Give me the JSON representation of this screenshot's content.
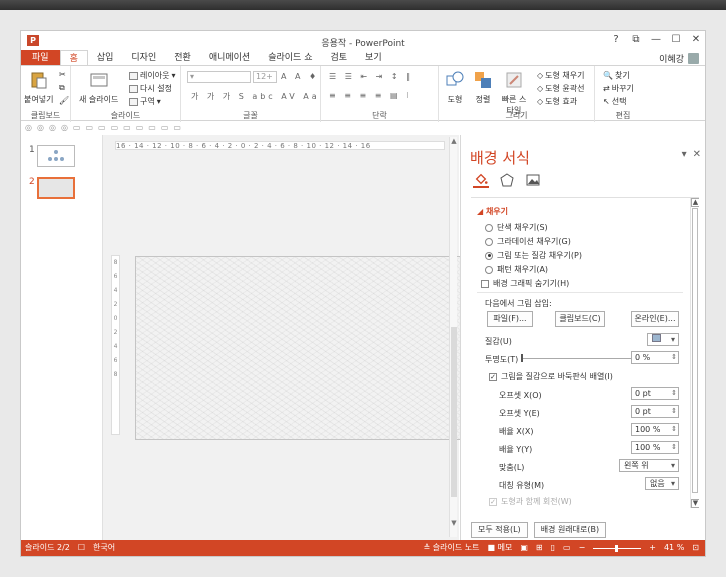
{
  "window": {
    "title": "응용작 - PowerPoint",
    "app_icon": "P",
    "controls": [
      "?",
      "⧉",
      "—",
      "☐",
      "✕"
    ]
  },
  "tabs": [
    {
      "label": "파일",
      "kind": "file"
    },
    {
      "label": "홈",
      "kind": "active"
    },
    {
      "label": "삽입"
    },
    {
      "label": "디자인"
    },
    {
      "label": "전환"
    },
    {
      "label": "애니메이션"
    },
    {
      "label": "슬라이드 쇼"
    },
    {
      "label": "검토"
    },
    {
      "label": "보기"
    }
  ],
  "user": {
    "name": "이혜강"
  },
  "ribbon": {
    "clipboard": {
      "paste": "붙여넣기",
      "label": "클립보드"
    },
    "slides": {
      "new_slide": "새 슬라이드",
      "layout": "레이아웃",
      "reset": "다시 설정",
      "section": "구역",
      "label": "슬라이드"
    },
    "font": {
      "size": "12+",
      "label": "글꼴"
    },
    "paragraph": {
      "label": "단락"
    },
    "drawing": {
      "shape": "도형",
      "arrange": "정렬",
      "quick_style": "빠른 스타일",
      "fill": "도형 채우기",
      "outline": "도형 윤곽선",
      "effect": "도형 효과",
      "label": "그리기"
    },
    "editing": {
      "find": "찾기",
      "replace": "바꾸기",
      "select": "선택",
      "label": "편집"
    }
  },
  "thumbnails": [
    {
      "num": "1"
    },
    {
      "num": "2"
    }
  ],
  "ruler": {
    "horizontal": "16 · 14 · 12 · 10 · 8 · 6 · 4 · 2 · 0 · 2 · 4 · 6 · 8 · 10 · 12 · 14 · 16",
    "vertical": [
      "8",
      "6",
      "4",
      "2",
      "0",
      "2",
      "4",
      "6",
      "8"
    ]
  },
  "pane": {
    "title": "배경 서식",
    "section": "채우기",
    "fill_options": [
      {
        "label": "단색 채우기(S)",
        "checked": false
      },
      {
        "label": "그라데이션 채우기(G)",
        "checked": false
      },
      {
        "label": "그림 또는 질감 채우기(P)",
        "checked": true
      },
      {
        "label": "패턴 채우기(A)",
        "checked": false
      }
    ],
    "hide_graphics": "배경 그래픽 숨기기(H)",
    "insert_from": "다음에서 그림 삽입:",
    "btn_file": "파일(F)...",
    "btn_clipboard": "클립보드(C)",
    "btn_online": "온라인(E)...",
    "texture_label": "질감(U)",
    "transparency_label": "투명도(T)",
    "transparency_value": "0 %",
    "tile_label": "그림을 질감으로 바둑판식 배열(I)",
    "offset_x_label": "오프셋 X(O)",
    "offset_x_value": "0 pt",
    "offset_y_label": "오프셋 Y(E)",
    "offset_y_value": "0 pt",
    "scale_x_label": "배율 X(X)",
    "scale_x_value": "100 %",
    "scale_y_label": "배율 Y(Y)",
    "scale_y_value": "100 %",
    "align_label": "맞춤(L)",
    "align_value": "왼쪽 위",
    "mirror_label": "대칭 유형(M)",
    "mirror_value": "없음",
    "rotate_label": "도형과 함께 회전(W)",
    "apply_all": "모두 적용(L)",
    "reset_bg": "배경 원래대로(B)"
  },
  "status": {
    "slide_info": "슬라이드 2/2",
    "language": "한국어",
    "notes": "슬라이드 노트",
    "comments": "메모",
    "zoom": "41 %"
  }
}
